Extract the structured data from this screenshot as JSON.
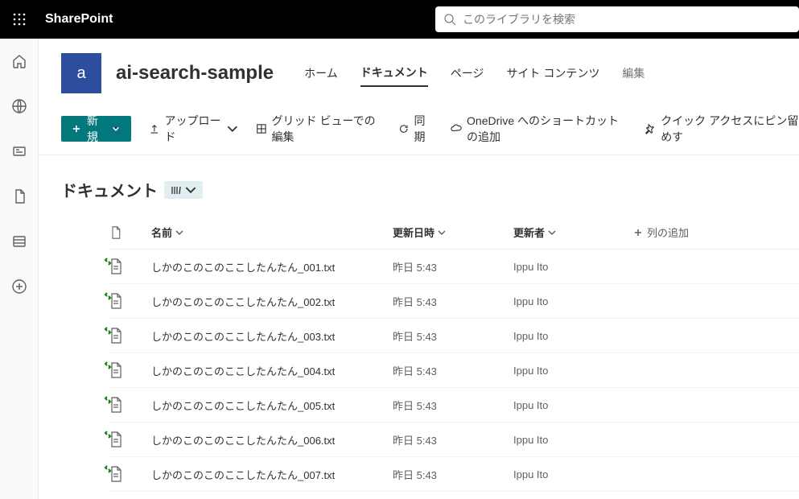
{
  "brand": {
    "app_name": "SharePoint"
  },
  "search": {
    "placeholder": "このライブラリを検索"
  },
  "site": {
    "logo_letter": "a",
    "title": "ai-search-sample",
    "nav": [
      {
        "label": "ホーム",
        "active": false
      },
      {
        "label": "ドキュメント",
        "active": true
      },
      {
        "label": "ページ",
        "active": false
      },
      {
        "label": "サイト コンテンツ",
        "active": false
      }
    ],
    "edit_label": "編集"
  },
  "commands": {
    "new_label": "新規",
    "upload_label": "アップロード",
    "grid_label": "グリッド ビューでの編集",
    "sync_label": "同期",
    "onedrive_label": "OneDrive へのショートカットの追加",
    "pin_label": "クイック アクセスにピン留めす"
  },
  "library": {
    "title": "ドキュメント"
  },
  "columns": {
    "name": "名前",
    "modified": "更新日時",
    "modified_by": "更新者",
    "add_column": "列の追加"
  },
  "files": [
    {
      "name": "しかのこのこのここしたんたん_001.txt",
      "modified": "昨日 5:43",
      "modified_by": "Ippu Ito"
    },
    {
      "name": "しかのこのこのここしたんたん_002.txt",
      "modified": "昨日 5:43",
      "modified_by": "Ippu Ito"
    },
    {
      "name": "しかのこのこのここしたんたん_003.txt",
      "modified": "昨日 5:43",
      "modified_by": "Ippu Ito"
    },
    {
      "name": "しかのこのこのここしたんたん_004.txt",
      "modified": "昨日 5:43",
      "modified_by": "Ippu Ito"
    },
    {
      "name": "しかのこのこのここしたんたん_005.txt",
      "modified": "昨日 5:43",
      "modified_by": "Ippu Ito"
    },
    {
      "name": "しかのこのこのここしたんたん_006.txt",
      "modified": "昨日 5:43",
      "modified_by": "Ippu Ito"
    },
    {
      "name": "しかのこのこのここしたんたん_007.txt",
      "modified": "昨日 5:43",
      "modified_by": "Ippu Ito"
    }
  ]
}
